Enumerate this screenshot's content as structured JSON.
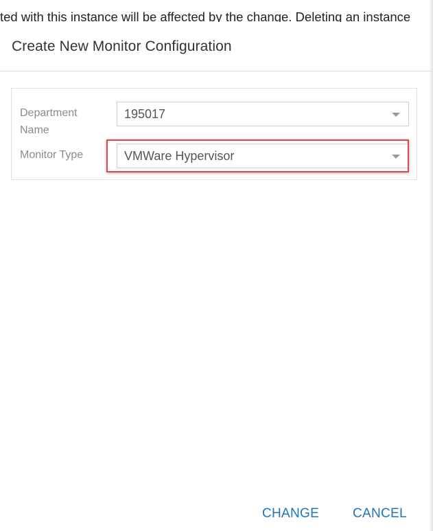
{
  "background_text": "ted with this instance will be affected by the change. Deleting an instance",
  "dialog": {
    "title": "Create New Monitor Configuration",
    "fields": {
      "department": {
        "label": "Department Name",
        "value": "195017"
      },
      "monitor_type": {
        "label": "Monitor Type",
        "value": "VMWare Hypervisor"
      }
    },
    "buttons": {
      "change_label": "CHANGE",
      "cancel_label": "CANCEL"
    }
  },
  "colors": {
    "link_blue": "#1e73be",
    "highlight_red": "#e04848",
    "label_gray": "#8a8a8a"
  },
  "icons": {
    "dropdown": "chevron-down-icon"
  }
}
